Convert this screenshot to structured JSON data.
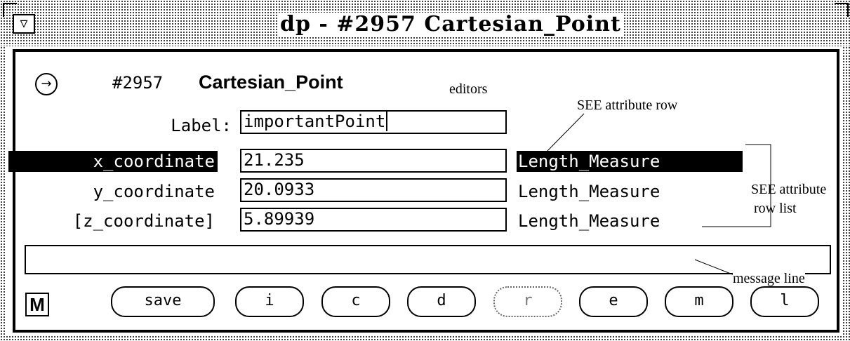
{
  "window": {
    "title": "dp - #2957 Cartesian_Point",
    "menu_icon": "window-menu-icon"
  },
  "header": {
    "entity_id": "#2957",
    "entity_type": "Cartesian_Point",
    "nav_icon": "circled-arrow-icon",
    "nav_glyph": "→"
  },
  "label_row": {
    "label": "Label:",
    "value": "importantPoint"
  },
  "attributes": [
    {
      "name": "x_coordinate",
      "value": "21.235",
      "type": "Length_Measure",
      "selected": true
    },
    {
      "name": "y_coordinate",
      "value": "20.0933",
      "type": "Length_Measure",
      "selected": false
    },
    {
      "name": "[z_coordinate]",
      "value": "5.89939",
      "type": "Length_Measure",
      "selected": false
    }
  ],
  "message_line": "",
  "buttons": {
    "mode": "M",
    "save": "save",
    "i": "i",
    "c": "c",
    "d": "d",
    "r": "r",
    "e": "e",
    "m": "m",
    "l": "l"
  },
  "annotations": {
    "editors": "editors",
    "see_attribute_row": "SEE attribute row",
    "see_attribute_row_list_1": "SEE attribute",
    "see_attribute_row_list_2": "row list",
    "message_line": "message line"
  }
}
